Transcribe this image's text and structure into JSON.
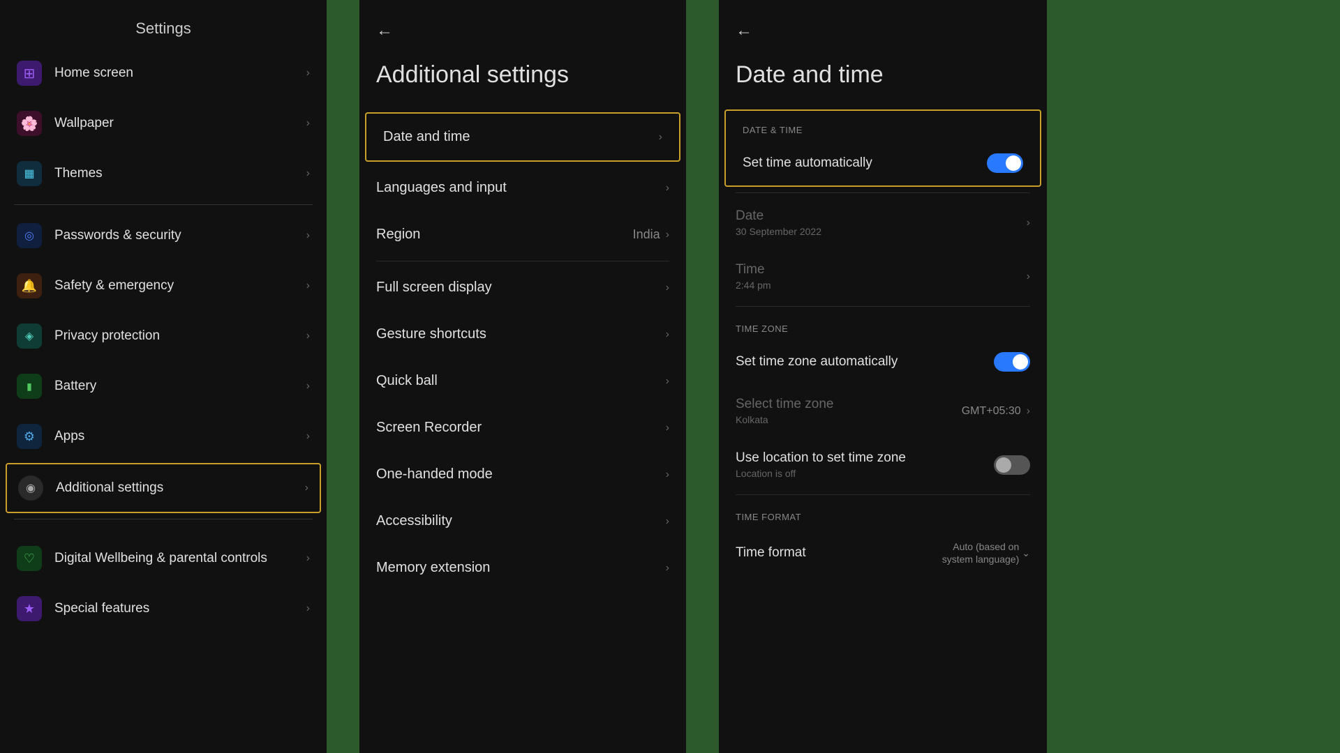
{
  "left": {
    "title": "Settings",
    "items": [
      {
        "id": "home-screen",
        "label": "Home screen",
        "icon": "⊞",
        "iconClass": "icon-purple",
        "highlighted": false
      },
      {
        "id": "wallpaper",
        "label": "Wallpaper",
        "icon": "🌸",
        "iconClass": "icon-pink",
        "highlighted": false
      },
      {
        "id": "themes",
        "label": "Themes",
        "icon": "▦",
        "iconClass": "icon-teal",
        "highlighted": false
      },
      {
        "id": "passwords-security",
        "label": "Passwords & security",
        "icon": "◎",
        "iconClass": "icon-blue",
        "highlighted": false
      },
      {
        "id": "safety-emergency",
        "label": "Safety & emergency",
        "icon": "🔔",
        "iconClass": "icon-orange",
        "highlighted": false
      },
      {
        "id": "privacy-protection",
        "label": "Privacy protection",
        "icon": "◈",
        "iconClass": "icon-cyan",
        "highlighted": false
      },
      {
        "id": "battery",
        "label": "Battery",
        "icon": "▮",
        "iconClass": "icon-green",
        "highlighted": false
      },
      {
        "id": "apps",
        "label": "Apps",
        "icon": "⚙",
        "iconClass": "icon-light-blue",
        "highlighted": false
      },
      {
        "id": "additional-settings",
        "label": "Additional settings",
        "icon": "◉",
        "iconClass": "icon-gray",
        "highlighted": true
      }
    ],
    "bottomItems": [
      {
        "id": "digital-wellbeing",
        "label": "Digital Wellbeing & parental controls",
        "icon": "♡",
        "iconClass": "icon-green"
      },
      {
        "id": "special-features",
        "label": "Special features",
        "icon": "★",
        "iconClass": "icon-purple"
      }
    ]
  },
  "middle": {
    "back_label": "←",
    "title": "Additional settings",
    "items": [
      {
        "id": "date-time",
        "label": "Date and time",
        "value": "",
        "highlighted": true
      },
      {
        "id": "languages-input",
        "label": "Languages and input",
        "value": "",
        "highlighted": false
      },
      {
        "id": "region",
        "label": "Region",
        "value": "India",
        "highlighted": false
      },
      {
        "id": "full-screen-display",
        "label": "Full screen display",
        "value": "",
        "highlighted": false
      },
      {
        "id": "gesture-shortcuts",
        "label": "Gesture shortcuts",
        "value": "",
        "highlighted": false
      },
      {
        "id": "quick-ball",
        "label": "Quick ball",
        "value": "",
        "highlighted": false
      },
      {
        "id": "screen-recorder",
        "label": "Screen Recorder",
        "value": "",
        "highlighted": false
      },
      {
        "id": "one-handed-mode",
        "label": "One-handed mode",
        "value": "",
        "highlighted": false
      },
      {
        "id": "accessibility",
        "label": "Accessibility",
        "value": "",
        "highlighted": false
      },
      {
        "id": "memory-extension",
        "label": "Memory extension",
        "value": "",
        "highlighted": false
      }
    ]
  },
  "right": {
    "back_label": "←",
    "title": "Date and time",
    "sections": [
      {
        "id": "date-time-section",
        "label": "DATE & TIME",
        "highlighted": true,
        "items": [
          {
            "id": "set-time-auto",
            "label": "Set time automatically",
            "type": "toggle",
            "toggled": true
          }
        ]
      },
      {
        "id": "date-section",
        "label": "",
        "highlighted": false,
        "items": [
          {
            "id": "date",
            "label": "Date",
            "sub": "30 September 2022",
            "type": "chevron"
          },
          {
            "id": "time",
            "label": "Time",
            "sub": "2:44 pm",
            "type": "chevron"
          }
        ]
      },
      {
        "id": "timezone-section",
        "label": "TIME ZONE",
        "highlighted": false,
        "items": [
          {
            "id": "set-timezone-auto",
            "label": "Set time zone automatically",
            "type": "toggle",
            "toggled": true
          },
          {
            "id": "select-timezone",
            "label": "Select time zone",
            "sub": "Kolkata",
            "value": "GMT+05:30",
            "type": "chevron"
          },
          {
            "id": "use-location-timezone",
            "label": "Use location to set time zone",
            "sub": "Location is off",
            "type": "toggle",
            "toggled": false
          }
        ]
      },
      {
        "id": "timeformat-section",
        "label": "TIME FORMAT",
        "highlighted": false,
        "items": [
          {
            "id": "time-format",
            "label": "Time format",
            "value": "Auto (based on\nsystem language)",
            "type": "dropdown"
          }
        ]
      }
    ]
  }
}
